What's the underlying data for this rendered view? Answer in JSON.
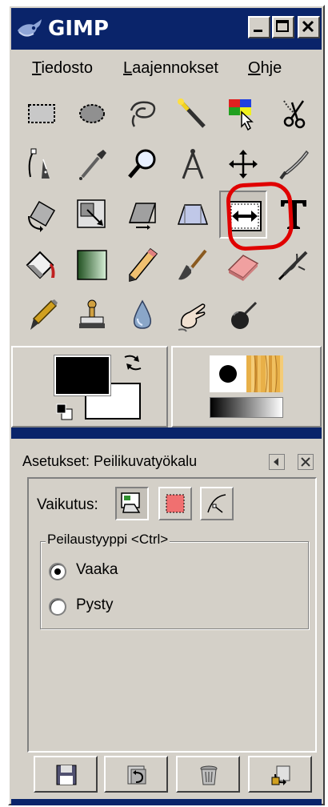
{
  "window": {
    "title": "GIMP",
    "controls": {
      "minimize": "_",
      "maximize": "□",
      "close": "X"
    }
  },
  "menu": {
    "items": [
      {
        "mnemonic": "T",
        "rest": "iedosto"
      },
      {
        "mnemonic": "L",
        "rest": "aajennokset"
      },
      {
        "mnemonic": "O",
        "rest": "hje"
      }
    ]
  },
  "toolbox": {
    "tools": [
      "rect-select",
      "ellipse-select",
      "free-select",
      "fuzzy-select",
      "select-by-color",
      "scissors",
      "paths",
      "color-picker",
      "magnify",
      "measure",
      "move",
      "crop",
      "rotate",
      "scale",
      "shear",
      "perspective",
      "flip",
      "text",
      "bucket-fill",
      "blend",
      "pencil",
      "paintbrush",
      "eraser",
      "airbrush",
      "ink",
      "clone",
      "blur-sharpen",
      "smudge",
      "dodge-burn"
    ],
    "active_tool": "flip",
    "highlight_color": "#e00000"
  },
  "colors": {
    "foreground": "#000000",
    "background": "#ffffff",
    "swap_icon": "swap-arrows-icon",
    "reset_icon": "default-colors-icon"
  },
  "brush_pattern_gradient": {
    "brush": "circle-brush",
    "pattern": "wood-pattern",
    "gradient": "black-to-white"
  },
  "tool_options": {
    "title": "Asetukset: Peilikuvatyökalu",
    "affect_label": "Vaikutus:",
    "affect_modes": [
      "layer",
      "selection",
      "path"
    ],
    "affect_active": "layer",
    "flip_type_label": "Peilaustyyppi <Ctrl>",
    "flip_options": [
      {
        "label": "Vaaka",
        "checked": true
      },
      {
        "label": "Pysty",
        "checked": false
      }
    ]
  },
  "bottom_buttons": [
    "save-options",
    "restore-options",
    "delete-options",
    "reset-options"
  ],
  "accent_colors": {
    "titlebar": "#0a246a",
    "face": "#d4d0c8"
  }
}
